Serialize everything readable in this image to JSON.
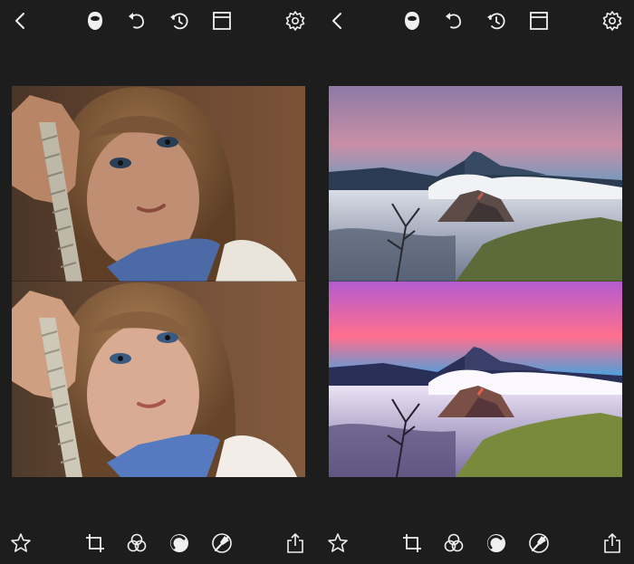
{
  "app": {
    "colors": {
      "background": "#1d1d1d",
      "icon": "#f0f0f0"
    }
  },
  "panels": [
    {
      "subject": "portrait",
      "top_toolbar": {
        "icons": [
          "back-chevron-icon",
          "face-mask-icon",
          "undo-icon",
          "revert-history-icon",
          "compare-frame-icon",
          "settings-gear-icon"
        ]
      },
      "bottom_toolbar": {
        "icons": [
          "star-icon",
          "crop-icon",
          "filters-circles-icon",
          "tone-dial-icon",
          "brush-icon",
          "share-icon"
        ]
      },
      "images": [
        "original",
        "edited"
      ]
    },
    {
      "subject": "landscape",
      "top_toolbar": {
        "icons": [
          "back-chevron-icon",
          "face-mask-icon",
          "undo-icon",
          "revert-history-icon",
          "compare-frame-icon",
          "settings-gear-icon"
        ]
      },
      "bottom_toolbar": {
        "icons": [
          "star-icon",
          "crop-icon",
          "filters-circles-icon",
          "tone-dial-icon",
          "brush-icon",
          "share-icon"
        ]
      },
      "images": [
        "original",
        "edited"
      ]
    }
  ]
}
